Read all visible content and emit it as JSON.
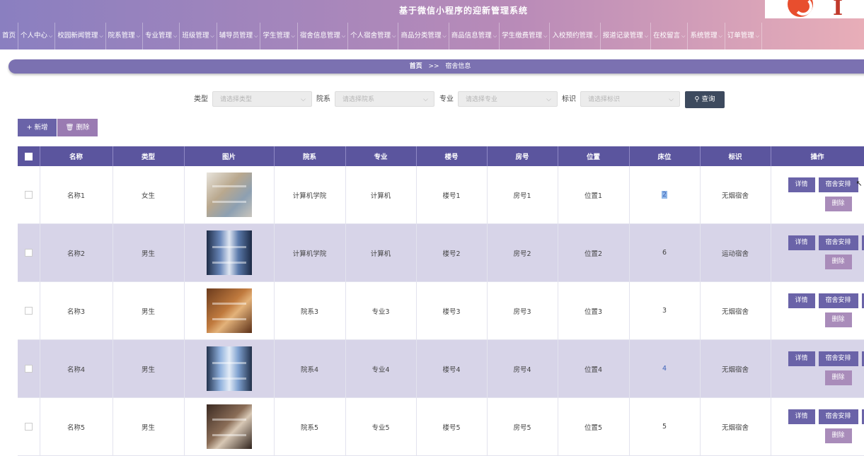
{
  "app": {
    "title": "基于微信小程序的迎新管理系统",
    "logo_letter": "I"
  },
  "nav": [
    {
      "label": "首页",
      "chevron": false
    },
    {
      "label": "个人中心",
      "chevron": true
    },
    {
      "label": "校园新闻管理",
      "chevron": true
    },
    {
      "label": "院系管理",
      "chevron": true
    },
    {
      "label": "专业管理",
      "chevron": true
    },
    {
      "label": "班级管理",
      "chevron": true
    },
    {
      "label": "辅导员管理",
      "chevron": true
    },
    {
      "label": "学生管理",
      "chevron": true
    },
    {
      "label": "宿舍信息管理",
      "chevron": true
    },
    {
      "label": "个人宿舍管理",
      "chevron": true
    },
    {
      "label": "商品分类管理",
      "chevron": true
    },
    {
      "label": "商品信息管理",
      "chevron": true
    },
    {
      "label": "学生缴费管理",
      "chevron": true
    },
    {
      "label": "入校预约管理",
      "chevron": true
    },
    {
      "label": "报道记录管理",
      "chevron": true
    },
    {
      "label": "在校留言",
      "chevron": true
    },
    {
      "label": "系统管理",
      "chevron": true
    },
    {
      "label": "订单管理",
      "chevron": true
    }
  ],
  "breadcrumb": {
    "home": "首页",
    "separator": ">>",
    "current": "宿舍信息"
  },
  "search": {
    "type_label": "类型",
    "type_placeholder": "请选择类型",
    "dept_label": "院系",
    "dept_placeholder": "请选择院系",
    "major_label": "专业",
    "major_placeholder": "请选择专业",
    "tag_label": "标识",
    "tag_placeholder": "请选择标识",
    "button": "查询"
  },
  "actions": {
    "add": "新增",
    "delete": "删除"
  },
  "table": {
    "columns": [
      "名称",
      "类型",
      "图片",
      "院系",
      "专业",
      "楼号",
      "房号",
      "位置",
      "床位",
      "标识",
      "操作"
    ],
    "rows": [
      {
        "name": "名称1",
        "type": "女生",
        "dept": "计算机学院",
        "major": "计算机",
        "building": "楼号1",
        "room": "房号1",
        "location": "位置1",
        "beds": "2",
        "tag": "无烟宿舍"
      },
      {
        "name": "名称2",
        "type": "男生",
        "dept": "计算机学院",
        "major": "计算机",
        "building": "楼号2",
        "room": "房号2",
        "location": "位置2",
        "beds": "6",
        "tag": "运动宿舍"
      },
      {
        "name": "名称3",
        "type": "男生",
        "dept": "院系3",
        "major": "专业3",
        "building": "楼号3",
        "room": "房号3",
        "location": "位置3",
        "beds": "3",
        "tag": "无烟宿舍"
      },
      {
        "name": "名称4",
        "type": "男生",
        "dept": "院系4",
        "major": "专业4",
        "building": "楼号4",
        "room": "房号4",
        "location": "位置4",
        "beds": "4",
        "tag": "无烟宿舍"
      },
      {
        "name": "名称5",
        "type": "男生",
        "dept": "院系5",
        "major": "专业5",
        "building": "楼号5",
        "room": "房号5",
        "location": "位置5",
        "beds": "5",
        "tag": "无烟宿舍"
      }
    ],
    "row_actions": {
      "detail": "详情",
      "assign": "宿舍安排",
      "delete": "删除"
    }
  },
  "colors": {
    "header_start": "#8a7fc0",
    "header_end": "#e8aeb8",
    "primary": "#6a63a8",
    "table_header": "#5b559e",
    "row_alt": "#d7d4e8",
    "danger_soft": "#a98cba",
    "search_button": "#3d4a5e"
  }
}
